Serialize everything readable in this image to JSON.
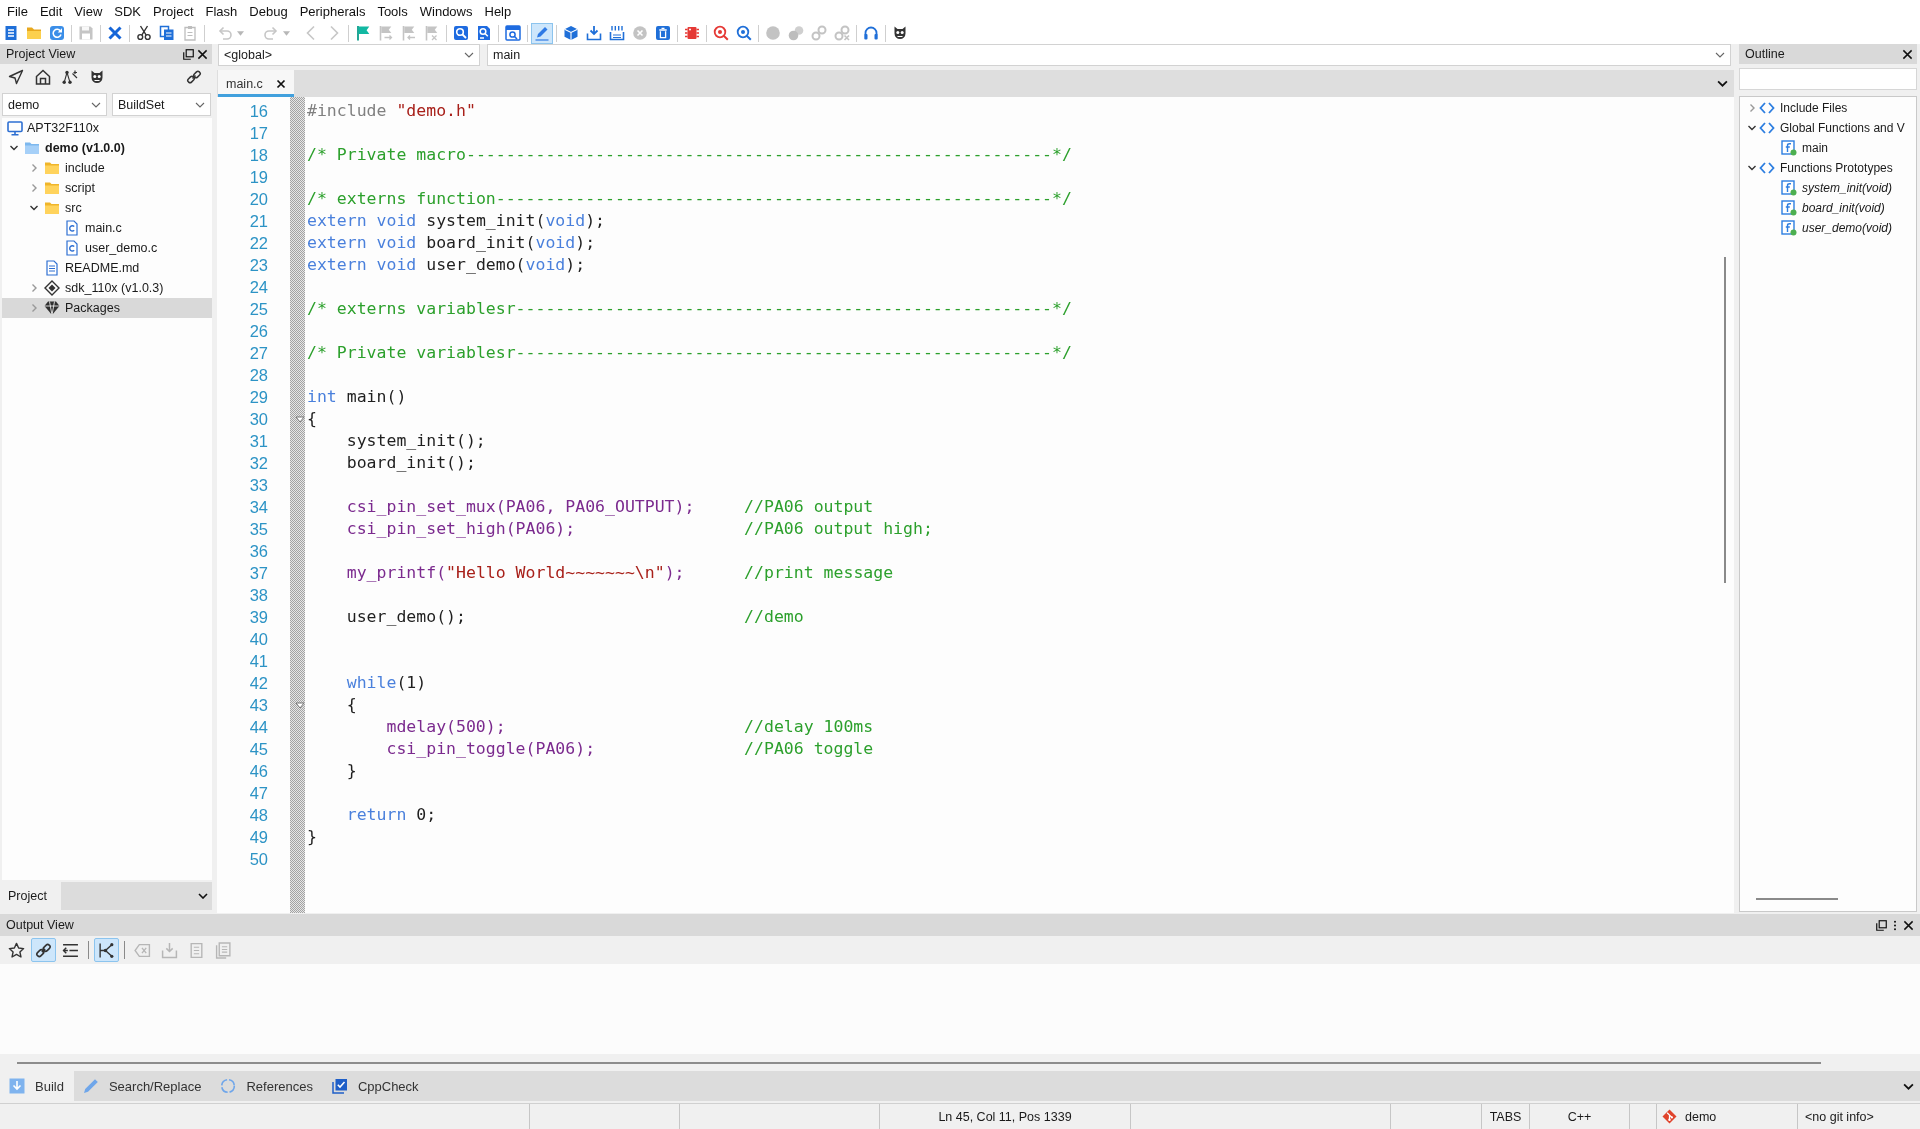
{
  "menu_bar": [
    "File",
    "Edit",
    "View",
    "SDK",
    "Project",
    "Flash",
    "Debug",
    "Peripherals",
    "Tools",
    "Windows",
    "Help"
  ],
  "toolbar": [
    [
      {
        "kind": "new",
        "disabled": false,
        "on": false
      },
      {
        "kind": "open",
        "disabled": false,
        "on": false
      },
      {
        "kind": "reload",
        "disabled": false,
        "on": false
      }
    ],
    [
      {
        "kind": "save",
        "disabled": true,
        "on": false
      }
    ],
    [
      {
        "kind": "close",
        "disabled": false,
        "on": false
      }
    ],
    [
      {
        "kind": "cut",
        "disabled": false,
        "on": false
      },
      {
        "kind": "copy",
        "disabled": false,
        "on": false
      },
      {
        "kind": "paste",
        "disabled": true,
        "on": false
      }
    ],
    [
      {
        "kind": "undo",
        "disabled": true,
        "on": false
      },
      {
        "kind": "redo",
        "disabled": true,
        "on": false
      },
      {
        "kind": "back",
        "disabled": true,
        "on": false
      },
      {
        "kind": "forward",
        "disabled": true,
        "on": false
      }
    ],
    [
      {
        "kind": "bookmark",
        "disabled": false,
        "on": false
      },
      {
        "kind": "nextmark",
        "disabled": true,
        "on": false
      },
      {
        "kind": "prevmark",
        "disabled": true,
        "on": false
      },
      {
        "kind": "clearmarks",
        "disabled": true,
        "on": false
      }
    ],
    [
      {
        "kind": "find",
        "disabled": false,
        "on": false
      },
      {
        "kind": "findfiles",
        "disabled": false,
        "on": false
      }
    ],
    [
      {
        "kind": "findsymbol",
        "disabled": false,
        "on": false
      }
    ],
    [
      {
        "kind": "edit",
        "disabled": false,
        "on": true
      }
    ],
    [
      {
        "kind": "build",
        "disabled": false,
        "on": false
      },
      {
        "kind": "download",
        "disabled": false,
        "on": false
      },
      {
        "kind": "downloadall",
        "disabled": false,
        "on": false
      },
      {
        "kind": "stop",
        "disabled": true,
        "on": false
      },
      {
        "kind": "erase",
        "disabled": false,
        "on": false
      }
    ],
    [
      {
        "kind": "load",
        "disabled": false,
        "on": false
      }
    ],
    [
      {
        "kind": "debug",
        "disabled": false,
        "on": false
      },
      {
        "kind": "debugrun",
        "disabled": false,
        "on": false
      }
    ],
    [
      {
        "kind": "breakpoint",
        "disabled": true,
        "on": false
      },
      {
        "kind": "breakpoints",
        "disabled": true,
        "on": false
      },
      {
        "kind": "connect",
        "disabled": true,
        "on": false
      },
      {
        "kind": "disconnect",
        "disabled": true,
        "on": false
      }
    ],
    [
      {
        "kind": "support",
        "disabled": false,
        "on": false
      }
    ],
    [
      {
        "kind": "plugin",
        "disabled": false,
        "on": false
      }
    ]
  ],
  "project_view": {
    "title": "Project View",
    "project": "demo",
    "build_set": "BuildSet",
    "workspace": "APT32F110x",
    "tree": [
      {
        "label": "demo (v1.0.0)",
        "kind": "project",
        "expanded": true,
        "selected": false,
        "children": [
          {
            "label": "include",
            "kind": "folder",
            "expanded": false,
            "selected": false
          },
          {
            "label": "script",
            "kind": "folder",
            "expanded": false,
            "selected": false
          },
          {
            "label": "src",
            "kind": "folder",
            "expanded": true,
            "selected": false,
            "children": [
              {
                "label": "main.c",
                "kind": "source",
                "selected": false
              },
              {
                "label": "user_demo.c",
                "kind": "source",
                "selected": false
              }
            ]
          },
          {
            "label": "README.md",
            "kind": "document",
            "selected": false
          },
          {
            "label": "sdk_110x (v1.0.3)",
            "kind": "sdk",
            "expanded": false,
            "selected": false
          },
          {
            "label": "Packages",
            "kind": "package",
            "expanded": false,
            "selected": true
          }
        ]
      }
    ],
    "tabs": [
      {
        "label": "Project",
        "selected": true
      }
    ]
  },
  "editor": {
    "scope": "<global>",
    "symbol": "main",
    "tabs": [
      {
        "label": "main.c",
        "selected": true
      }
    ],
    "lines": [
      {
        "number": "16",
        "fold": false,
        "tokens": [
          {
            "kind": "preproc",
            "text": "#include "
          },
          {
            "kind": "string",
            "text": "\"demo.h\""
          }
        ]
      },
      {
        "number": "17",
        "fold": false
      },
      {
        "number": "18",
        "fold": false,
        "tokens": [
          {
            "kind": "comment",
            "text": "/* Private macro-----------------------------------------------------------*/"
          }
        ]
      },
      {
        "number": "19",
        "fold": false
      },
      {
        "number": "20",
        "fold": false,
        "tokens": [
          {
            "kind": "comment",
            "text": "/* externs function--------------------------------------------------------*/"
          }
        ]
      },
      {
        "number": "21",
        "fold": false,
        "tokens": [
          {
            "kind": "keyword",
            "text": "extern void"
          },
          {
            "kind": "plain",
            "text": " system_init("
          },
          {
            "kind": "keyword",
            "text": "void"
          },
          {
            "kind": "plain",
            "text": ");"
          }
        ]
      },
      {
        "number": "22",
        "fold": false,
        "tokens": [
          {
            "kind": "keyword",
            "text": "extern void"
          },
          {
            "kind": "plain",
            "text": " board_init("
          },
          {
            "kind": "keyword",
            "text": "void"
          },
          {
            "kind": "plain",
            "text": ");"
          }
        ]
      },
      {
        "number": "23",
        "fold": false,
        "tokens": [
          {
            "kind": "keyword",
            "text": "extern void"
          },
          {
            "kind": "plain",
            "text": " user_demo("
          },
          {
            "kind": "keyword",
            "text": "void"
          },
          {
            "kind": "plain",
            "text": ");"
          }
        ]
      },
      {
        "number": "24",
        "fold": false
      },
      {
        "number": "25",
        "fold": false,
        "tokens": [
          {
            "kind": "comment",
            "text": "/* externs variablesr------------------------------------------------------*/"
          }
        ]
      },
      {
        "number": "26",
        "fold": false
      },
      {
        "number": "27",
        "fold": false,
        "tokens": [
          {
            "kind": "comment",
            "text": "/* Private variablesr------------------------------------------------------*/"
          }
        ]
      },
      {
        "number": "28",
        "fold": false
      },
      {
        "number": "29",
        "fold": false,
        "tokens": [
          {
            "kind": "keyword",
            "text": "int"
          },
          {
            "kind": "plain",
            "text": " main()"
          }
        ]
      },
      {
        "number": "30",
        "fold": true,
        "tokens": [
          {
            "kind": "plain",
            "text": "{"
          }
        ]
      },
      {
        "number": "31",
        "fold": false,
        "tokens": [
          {
            "kind": "plain",
            "text": "    system_init();"
          }
        ]
      },
      {
        "number": "32",
        "fold": false,
        "tokens": [
          {
            "kind": "plain",
            "text": "    board_init();"
          }
        ]
      },
      {
        "number": "33",
        "fold": false
      },
      {
        "number": "34",
        "fold": false,
        "tokens": [
          {
            "kind": "call",
            "text": "    csi_pin_set_mux(PA06, PA06_OUTPUT);     "
          },
          {
            "kind": "comment",
            "text": "//PA06 output"
          }
        ]
      },
      {
        "number": "35",
        "fold": false,
        "tokens": [
          {
            "kind": "call",
            "text": "    csi_pin_set_high(PA06);                 "
          },
          {
            "kind": "comment",
            "text": "//PA06 output high;"
          }
        ]
      },
      {
        "number": "36",
        "fold": false
      },
      {
        "number": "37",
        "fold": false,
        "tokens": [
          {
            "kind": "call",
            "text": "    my_printf("
          },
          {
            "kind": "string",
            "text": "\"Hello World~~~~~~~\\n\""
          },
          {
            "kind": "call",
            "text": ");      "
          },
          {
            "kind": "comment",
            "text": "//print message"
          }
        ]
      },
      {
        "number": "38",
        "fold": false
      },
      {
        "number": "39",
        "fold": false,
        "tokens": [
          {
            "kind": "plain",
            "text": "    user_demo();                            "
          },
          {
            "kind": "comment",
            "text": "//demo"
          }
        ]
      },
      {
        "number": "40",
        "fold": false
      },
      {
        "number": "41",
        "fold": false
      },
      {
        "number": "42",
        "fold": false,
        "tokens": [
          {
            "kind": "keyword",
            "text": "    while"
          },
          {
            "kind": "plain",
            "text": "(1)"
          }
        ]
      },
      {
        "number": "43",
        "fold": true,
        "tokens": [
          {
            "kind": "plain",
            "text": "    {"
          }
        ]
      },
      {
        "number": "44",
        "fold": false,
        "tokens": [
          {
            "kind": "call",
            "text": "        mdelay(500);                        "
          },
          {
            "kind": "comment",
            "text": "//delay 100ms"
          }
        ]
      },
      {
        "number": "45",
        "fold": false,
        "tokens": [
          {
            "kind": "call",
            "text": "        csi_pin_toggle(PA06);               "
          },
          {
            "kind": "comment",
            "text": "//PA06 toggle"
          }
        ]
      },
      {
        "number": "46",
        "fold": false,
        "tokens": [
          {
            "kind": "plain",
            "text": "    }"
          }
        ]
      },
      {
        "number": "47",
        "fold": false
      },
      {
        "number": "48",
        "fold": false,
        "tokens": [
          {
            "kind": "keyword",
            "text": "    return"
          },
          {
            "kind": "plain",
            "text": " 0;"
          }
        ]
      },
      {
        "number": "49",
        "fold": false,
        "tokens": [
          {
            "kind": "plain",
            "text": "}"
          }
        ]
      },
      {
        "number": "50",
        "fold": false
      }
    ]
  },
  "outline": {
    "title": "Outline",
    "tree": [
      {
        "label": "Include Files",
        "kind": "group",
        "expanded": false,
        "selected": false
      },
      {
        "label": "Global Functions and V",
        "kind": "group",
        "expanded": true,
        "selected": false,
        "children": [
          {
            "label": "main",
            "kind": "function",
            "selected": false
          }
        ]
      },
      {
        "label": "Functions Prototypes",
        "kind": "group",
        "expanded": true,
        "selected": false,
        "children": [
          {
            "label": "system_init(void)",
            "kind": "prototype",
            "selected": false
          },
          {
            "label": "board_init(void)",
            "kind": "prototype",
            "selected": false
          },
          {
            "label": "user_demo(void)",
            "kind": "prototype",
            "selected": false
          }
        ]
      }
    ]
  },
  "output_view": {
    "title": "Output View",
    "tools": [
      [
        {
          "kind": "favorite",
          "disabled": false,
          "on": false
        },
        {
          "kind": "link",
          "disabled": false,
          "on": true
        },
        {
          "kind": "wrap",
          "disabled": false,
          "on": false
        }
      ],
      [
        {
          "kind": "tree",
          "disabled": false,
          "on": true
        }
      ],
      [
        {
          "kind": "clear",
          "disabled": true,
          "on": false
        },
        {
          "kind": "save",
          "disabled": true,
          "on": false
        },
        {
          "kind": "copy",
          "disabled": true,
          "on": false
        },
        {
          "kind": "copyall",
          "disabled": true,
          "on": false
        }
      ]
    ],
    "tabs": [
      {
        "label": "Build",
        "kind": "build",
        "selected": true
      },
      {
        "label": "Search/Replace",
        "kind": "search",
        "selected": false
      },
      {
        "label": "References",
        "kind": "references",
        "selected": false
      },
      {
        "label": "CppCheck",
        "kind": "cppcheck",
        "selected": false
      }
    ]
  },
  "status_bar": {
    "position": "Ln 45, Col 11, Pos 1339",
    "indentation": "TABS",
    "language": "C++",
    "branch": "demo",
    "git_info": "<no git info>"
  }
}
